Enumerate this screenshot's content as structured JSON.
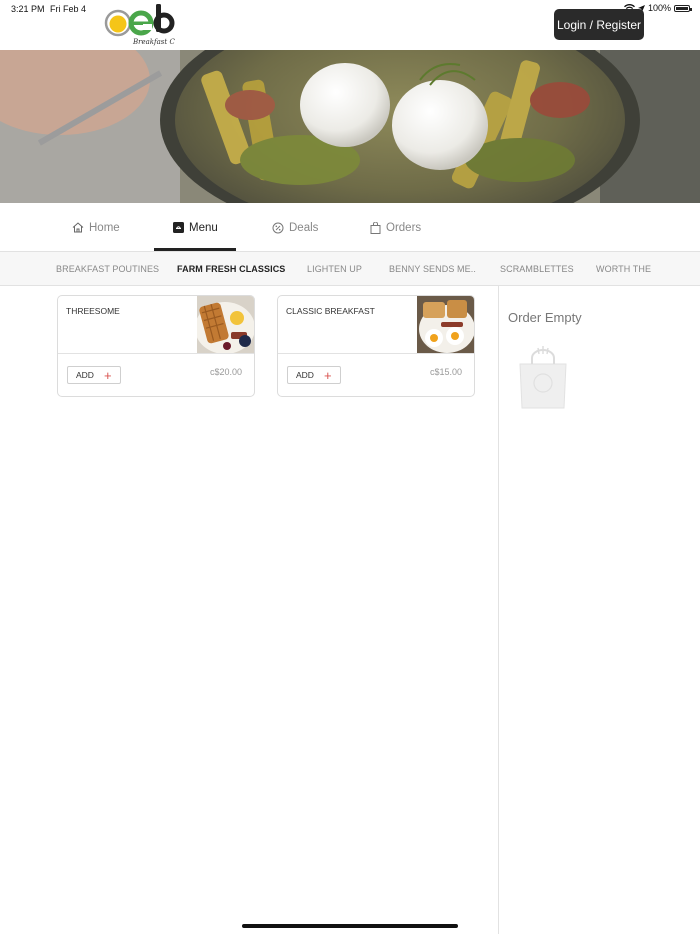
{
  "status_bar": {
    "time": "3:21 PM",
    "date": "Fri Feb 4",
    "battery": "100%"
  },
  "header": {
    "logo_text": "oeb",
    "logo_tagline": "Breakfast Co.",
    "login_label": "Login / Register"
  },
  "nav": {
    "tabs": [
      {
        "label": "Home",
        "icon": "home-icon"
      },
      {
        "label": "Menu",
        "icon": "menu-icon"
      },
      {
        "label": "Deals",
        "icon": "deals-icon"
      },
      {
        "label": "Orders",
        "icon": "bag-icon"
      }
    ],
    "active_tab": "Menu"
  },
  "categories": {
    "items": [
      "BREAKFAST POUTINES",
      "FARM FRESH CLASSICS",
      "LIGHTEN UP",
      "BENNY SENDS ME..",
      "SCRAMBLETTES",
      "WORTH THE"
    ],
    "active": "FARM FRESH CLASSICS"
  },
  "menu_items": [
    {
      "name": "THREESOME",
      "price": "c$20.00",
      "add_label": "ADD",
      "add_symbol": "+"
    },
    {
      "name": "CLASSIC BREAKFAST",
      "price": "c$15.00",
      "add_label": "ADD",
      "add_symbol": "+"
    }
  ],
  "order": {
    "empty_label": "Order Empty"
  },
  "colors": {
    "accent_red": "#d9534f",
    "logo_yellow": "#f5c518",
    "logo_green": "#4aa64a",
    "dark_button": "#2a2a2a"
  }
}
